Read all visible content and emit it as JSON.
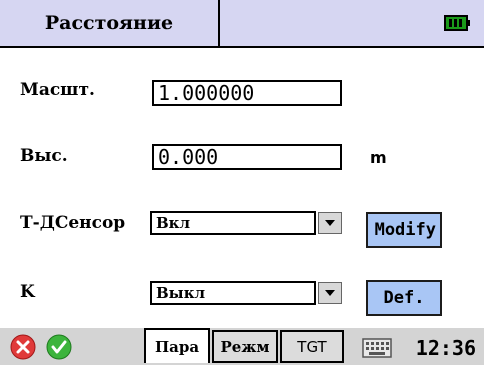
{
  "header": {
    "title": "Расстояние",
    "battery_icon": "battery-full-icon",
    "battery_color": "#1a9a1a"
  },
  "form": {
    "scale": {
      "label": "Масшт.",
      "value": "1.000000"
    },
    "height": {
      "label": "Выс.",
      "value": "0.000",
      "unit": "m"
    },
    "t_p_sensor": {
      "label": "Т-ДСенсор",
      "value": "Вкл",
      "button_label": "Modify"
    },
    "k": {
      "label": "K",
      "value": "Выкл",
      "button_label": "Def."
    }
  },
  "taskbar": {
    "close_icon": "close-icon",
    "ok_icon": "check-icon",
    "tabs": [
      {
        "label": "Пара",
        "active": true
      },
      {
        "label": "Режм",
        "active": false
      },
      {
        "label": "TGT",
        "active": false
      }
    ],
    "keyboard_icon": "keyboard-icon",
    "clock": "12:36"
  },
  "colors": {
    "header_bg": "#d6d6f2",
    "button_bg": "#a9c6f5",
    "taskbar_bg": "#d4d4d4",
    "close_red": "#e03a3a",
    "ok_green": "#3cb43c"
  }
}
